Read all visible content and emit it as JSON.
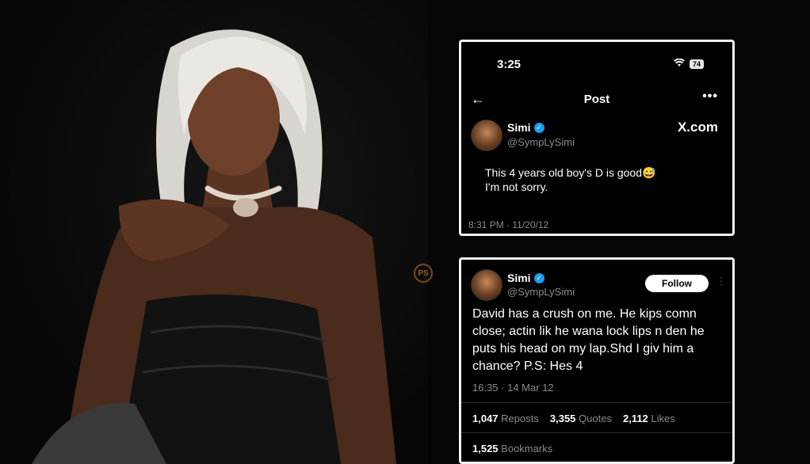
{
  "photo": {
    "alt": "Woman with platinum bob and pearl choker"
  },
  "watermark": {
    "text": "PS"
  },
  "card1": {
    "time": "3:25",
    "battery": "74",
    "back_icon": "back-arrow-icon",
    "title": "Post",
    "more": "•••",
    "name": "Simi",
    "handle": "@SympLySimi",
    "brand": "X.com",
    "text_line1": "This 4 years old boy's D is good😅",
    "text_line2": "I'm not sorry.",
    "meta": "8:31 PM · 11/20/12"
  },
  "card2": {
    "name": "Simi",
    "handle": "@SympLySimi",
    "follow_label": "Follow",
    "more": "⋮",
    "text": "David has a crush on me. He kips comn close; actin lik he wana lock lips n den he puts his head on my lap.Shd I giv him a chance? P.S: Hes 4",
    "meta": "16:35 · 14 Mar 12",
    "reposts_count": "1,047",
    "reposts_label": "Reposts",
    "quotes_count": "3,355",
    "quotes_label": "Quotes",
    "likes_count": "2,112",
    "likes_label": "Likes",
    "bookmarks_count": "1,525",
    "bookmarks_label": "Bookmarks"
  }
}
